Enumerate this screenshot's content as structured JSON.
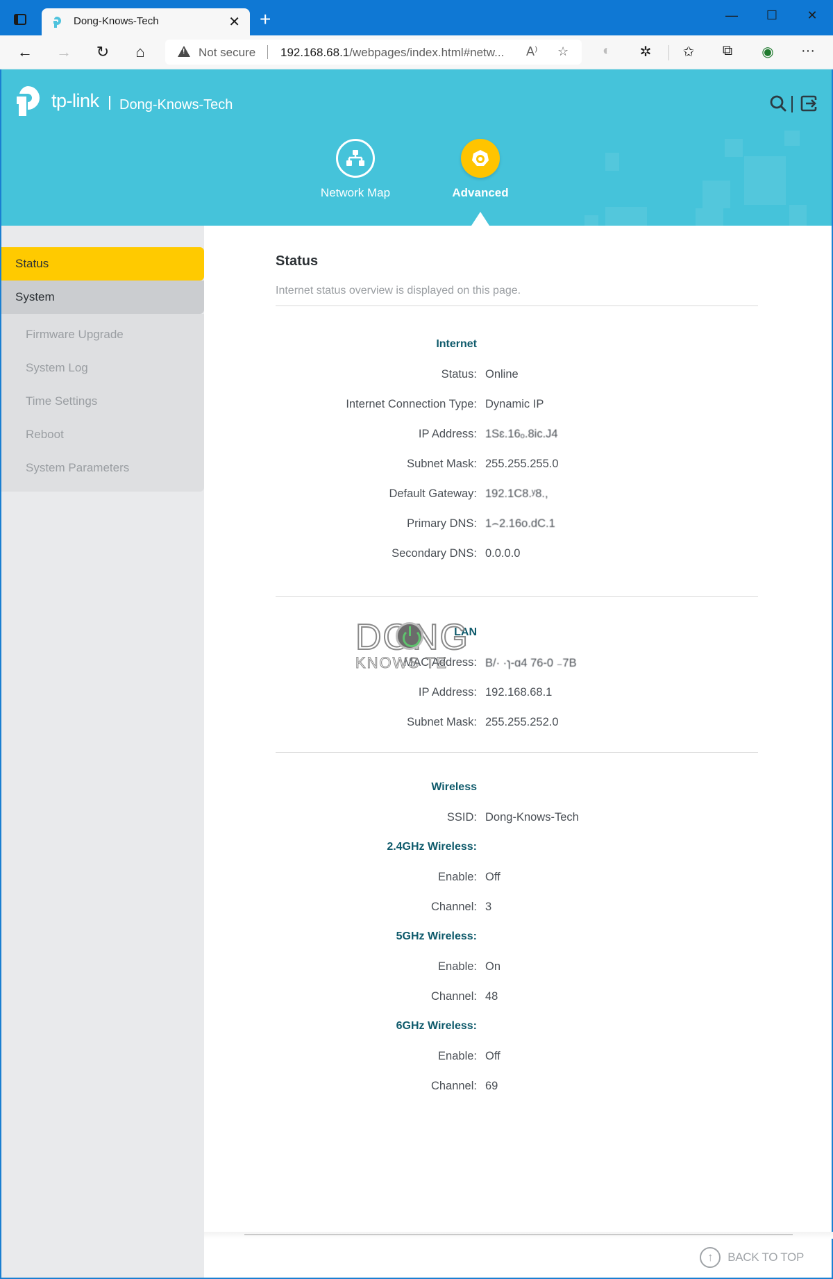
{
  "browser": {
    "tab_title": "Dong-Knows-Tech",
    "new_tab_symbol": "+",
    "close_symbol": "✕",
    "security_label": "Not secure",
    "url_host": "192.168.68.1",
    "url_path": "/webpages/index.html#netw...",
    "window_controls": {
      "minimize": "—",
      "maximize": "☐",
      "close": "✕"
    },
    "icons": {
      "back": "←",
      "forward": "→",
      "reload": "↻",
      "home": "⌂",
      "read_aloud": "A⁾",
      "add_favorite": "☆",
      "extension_profile": "◐",
      "extensions": "✲",
      "favorites": "✩",
      "collections": "⧉",
      "profile": "◉",
      "more": "···"
    }
  },
  "router": {
    "brand": "tp-link",
    "site_name": "Dong-Knows-Tech",
    "nav": [
      {
        "label": "Network Map",
        "icon": "network-map-icon",
        "active": false
      },
      {
        "label": "Advanced",
        "icon": "advanced-gear-icon",
        "active": true
      }
    ],
    "accent_color": "#45c3da",
    "active_color": "#ffca00"
  },
  "sidebar": {
    "items": [
      {
        "label": "Status",
        "active": true
      },
      {
        "label": "System",
        "expanded": true
      }
    ],
    "sub_items": [
      {
        "label": "Firmware Upgrade"
      },
      {
        "label": "System Log"
      },
      {
        "label": "Time Settings"
      },
      {
        "label": "Reboot"
      },
      {
        "label": "System Parameters"
      }
    ]
  },
  "content": {
    "title": "Status",
    "description": "Internet status overview is displayed on this page.",
    "internet": {
      "title": "Internet",
      "rows": [
        {
          "label": "Status:",
          "value": "Online"
        },
        {
          "label": "Internet Connection Type:",
          "value": "Dynamic IP"
        },
        {
          "label": "IP Address:",
          "value": "1Sɛ.16ₒ.8ic.J4"
        },
        {
          "label": "Subnet Mask:",
          "value": "255.255.255.0"
        },
        {
          "label": "Default Gateway:",
          "value": "192.1C8.ʸ8.,"
        },
        {
          "label": "Primary DNS:",
          "value": "1⌢2.16o.dC.1"
        },
        {
          "label": "Secondary DNS:",
          "value": "0.0.0.0"
        }
      ]
    },
    "lan": {
      "title": "LAN",
      "rows": [
        {
          "label": "MAC Address:",
          "value": "B/·  ·ɿ-ɑ4 76-0  ₋7B"
        },
        {
          "label": "IP Address:",
          "value": "192.168.68.1"
        },
        {
          "label": "Subnet Mask:",
          "value": "255.255.252.0"
        }
      ]
    },
    "wireless": {
      "title": "Wireless",
      "ssid_label": "SSID:",
      "ssid_value": "Dong-Knows-Tech",
      "bands": [
        {
          "title": "2.4GHz Wireless:",
          "enable_label": "Enable:",
          "enable": "Off",
          "channel_label": "Channel:",
          "channel": "3"
        },
        {
          "title": "5GHz Wireless:",
          "enable_label": "Enable:",
          "enable": "On",
          "channel_label": "Channel:",
          "channel": "48"
        },
        {
          "title": "6GHz Wireless:",
          "enable_label": "Enable:",
          "enable": "Off",
          "channel_label": "Channel:",
          "channel": "69"
        }
      ]
    },
    "back_to_top": "BACK TO TOP"
  },
  "watermark": {
    "line1": "DONG",
    "line2": "KNOWS TE"
  }
}
